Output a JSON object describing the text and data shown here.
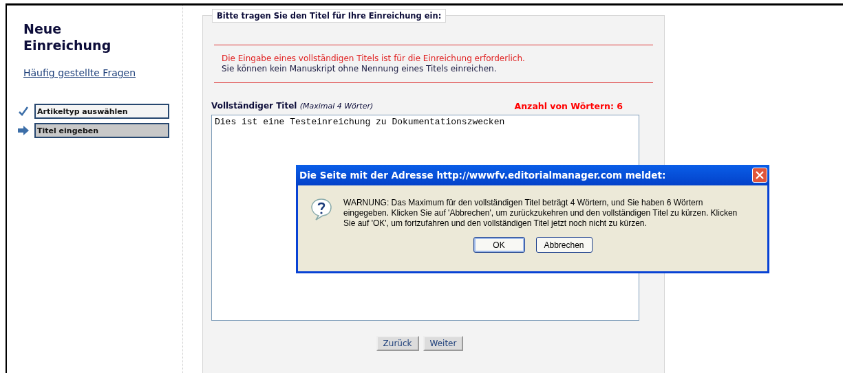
{
  "sidebar": {
    "title": "Neue Einreichung",
    "faq_link": "Häufig gestellte Fragen",
    "steps": [
      {
        "label": "Artikeltyp auswählen",
        "kind": "done",
        "selected": false
      },
      {
        "label": "Titel eingeben",
        "kind": "current",
        "selected": true
      }
    ]
  },
  "form": {
    "legend": "Bitte tragen Sie den Titel für Ihre Einreichung ein:",
    "notice": {
      "error": "Die Eingabe eines vollständigen Titels ist für die Einreichung erforderlich.",
      "info": "Sie können kein Manuskript ohne Nennung eines Titels einreichen."
    },
    "field_label": "Vollständiger Titel",
    "field_hint": "(Maximal 4 Wörter)",
    "word_count": "Anzahl von Wörtern: 6",
    "value": "Dies ist eine Testeinreichung zu Dokumentationszwecken",
    "buttons": [
      "Zurück",
      "Weiter"
    ]
  },
  "dialog": {
    "title": "Die Seite mit der Adresse http://wwwfv.editorialmanager.com meldet:",
    "message": "WARNUNG: Das Maximum für den vollständigen Titel beträgt 4 Wörtern, und Sie haben 6 Wörtern eingegeben. Klicken Sie auf 'Abbrechen', um zurückzukehren und den vollständigen Titel zu kürzen. Klicken Sie auf 'OK', um fortzufahren und den vollständigen Titel jetzt noch nicht zu kürzen.",
    "buttons": [
      {
        "label": "OK",
        "selected": true
      },
      {
        "label": "Abbrechen",
        "selected": false
      }
    ]
  }
}
